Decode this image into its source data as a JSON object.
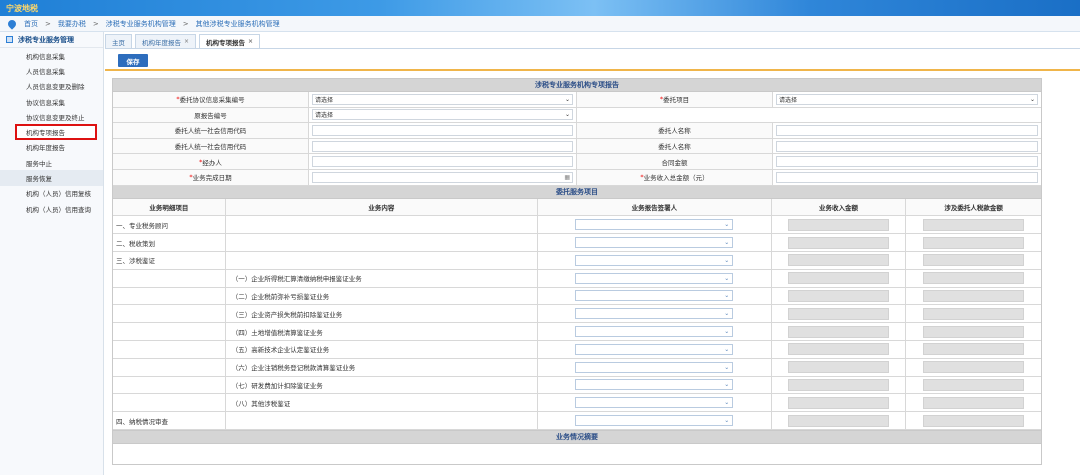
{
  "header": {
    "logo_text": "宁波地税"
  },
  "breadcrumb": {
    "items": [
      "首页",
      "我要办税",
      "涉税专业服务机构管理",
      "其他涉税专业服务机构管理"
    ],
    "sep": ">"
  },
  "sidebar": {
    "title": "涉税专业服务管理",
    "items": [
      "机构信息采集",
      "人员信息采集",
      "人员信息变更及删除",
      "协议信息采集",
      "协议信息变更及终止",
      "机构专项报告",
      "机构年度报告",
      "服务中止",
      "服务恢复",
      "机构（人员）信用复核",
      "机构（人员）信用查询"
    ]
  },
  "tabs": [
    {
      "label": "主页",
      "closable": false
    },
    {
      "label": "机构年度报告",
      "closable": true
    },
    {
      "label": "机构专项报告",
      "closable": true
    }
  ],
  "toolbar": {
    "save_label": "保存"
  },
  "form": {
    "title": "涉税专业服务机构专项报告",
    "rows": [
      {
        "l1": "委托协议信息采集编号",
        "r1": true,
        "v1": "请选择",
        "l2": "委托项目",
        "r2": true,
        "v2": "请选择"
      },
      {
        "l1": "原报告编号",
        "r1": false,
        "v1": "请选择"
      },
      {
        "l1": "委托人统一社会信用代码",
        "r1": false,
        "l2": "委托人名称",
        "r2": false
      },
      {
        "l1": "委托人统一社会信用代码",
        "r1": false,
        "l2": "委托人名称",
        "r2": false
      },
      {
        "l1": "经办人",
        "r1": true,
        "l2": "合同金额",
        "r2": false
      },
      {
        "l1": "业务完成日期",
        "r1": true,
        "l2": "业务收入总金额（元）",
        "r2": true
      }
    ],
    "date_icon": "calendar-icon",
    "req_mark": "*",
    "placeholder_select": "请选择"
  },
  "service": {
    "title": "委托服务项目",
    "headers": [
      "业务明细项目",
      "业务内容",
      "业务报告签署人",
      "业务收入金额",
      "涉及委托人税款金额"
    ],
    "rows": [
      {
        "item": "一、专业税务顾问",
        "content": ""
      },
      {
        "item": "二、税收策划",
        "content": ""
      },
      {
        "item": "三、涉税鉴证",
        "content": ""
      },
      {
        "item": "",
        "content": "（一）企业所得税汇算清缴纳税申报鉴证业务"
      },
      {
        "item": "",
        "content": "（二）企业税前弥补亏损鉴证业务"
      },
      {
        "item": "",
        "content": "（三）企业资产损失税前扣除鉴证业务"
      },
      {
        "item": "",
        "content": "（四）土地增值税清算鉴证业务"
      },
      {
        "item": "",
        "content": "（五）高新技术企业认定鉴证业务"
      },
      {
        "item": "",
        "content": "（六）企业注销税务登记税款清算鉴证业务"
      },
      {
        "item": "",
        "content": "（七）研发费加计扣除鉴证业务"
      },
      {
        "item": "",
        "content": "（八）其他涉税鉴证"
      },
      {
        "item": "四、纳税情况审查",
        "content": ""
      }
    ]
  },
  "summary": {
    "title": "业务情况摘要"
  }
}
